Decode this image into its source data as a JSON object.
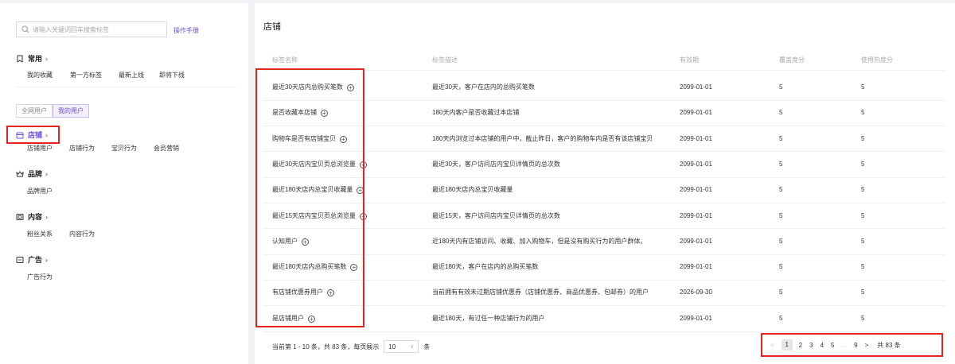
{
  "sidebar": {
    "search_placeholder": "请输入关键词回车搜索标签",
    "manual_link": "操作手册",
    "sections": [
      {
        "title": "常用",
        "items": [
          "我的收藏",
          "第一方标签",
          "最新上线",
          "即将下线"
        ]
      },
      {
        "title": "店铺",
        "items": [
          "店铺用户",
          "店铺行为",
          "宝贝行为",
          "会员营销"
        ]
      },
      {
        "title": "品牌",
        "items": [
          "品牌用户"
        ]
      },
      {
        "title": "内容",
        "items": [
          "粉丝关系",
          "内容行为"
        ]
      },
      {
        "title": "广告",
        "items": [
          "广告行为"
        ]
      }
    ],
    "scope_tabs": [
      "全网用户",
      "我的用户"
    ],
    "active_scope": "我的用户"
  },
  "main": {
    "title": "店铺",
    "columns": [
      "标签名称",
      "标签描述",
      "有效期",
      "覆盖度分",
      "使用热度分"
    ],
    "rows": [
      {
        "name": "最近30天店内总购买笔数",
        "desc": "最近30天，客户在店内的总购买笔数",
        "expiry": "2099-01-01",
        "coverage": "5",
        "heat": "5"
      },
      {
        "name": "是否收藏本店铺",
        "desc": "180天内客户是否收藏过本店铺",
        "expiry": "2099-01-01",
        "coverage": "5",
        "heat": "5"
      },
      {
        "name": "购物车是否有店铺宝贝",
        "desc": "180天内浏览过本店铺的用户中，截止昨日，客户的购物车内是否有该店铺宝贝",
        "expiry": "2099-01-01",
        "coverage": "5",
        "heat": "5"
      },
      {
        "name": "最近30天店内宝贝页总浏览量",
        "desc": "最近30天，客户访问店内宝贝详情页的总次数",
        "expiry": "2099-01-01",
        "coverage": "5",
        "heat": "5"
      },
      {
        "name": "最近180天店内总宝贝收藏量",
        "desc": "最近180天店内总宝贝收藏量",
        "expiry": "2099-01-01",
        "coverage": "5",
        "heat": "5"
      },
      {
        "name": "最近15天店内宝贝页总浏览量",
        "desc": "最近15天，客户访问店内宝贝详情页的总次数",
        "expiry": "2099-01-01",
        "coverage": "5",
        "heat": "5"
      },
      {
        "name": "认知用户",
        "desc": "近180天内有店铺访问、收藏、加入购物车，但是没有购买行为的用户群体。",
        "expiry": "2099-01-01",
        "coverage": "5",
        "heat": "5"
      },
      {
        "name": "最近180天店内总购买笔数",
        "desc": "最近180天，客户在店内的总购买笔数",
        "expiry": "2099-01-01",
        "coverage": "5",
        "heat": "5"
      },
      {
        "name": "有店铺优惠券用户",
        "desc": "当前拥有有效未过期店铺优惠券（店铺优惠券、商品优惠券、包邮券）的用户",
        "expiry": "2026-09-30",
        "coverage": "5",
        "heat": "5"
      },
      {
        "name": "是店铺用户",
        "desc": "最近180天，有过任一种店铺行为的用户",
        "expiry": "2099-01-01",
        "coverage": "5",
        "heat": "5"
      }
    ],
    "footer": {
      "range_text": "当前第 1 - 10 条，共 83 条，每页展示",
      "page_size": "10",
      "unit": "条"
    },
    "pagination": {
      "prev": "<",
      "pages": [
        "1",
        "2",
        "3",
        "4",
        "5",
        "...",
        "9"
      ],
      "next": ">",
      "total": "共 83 条"
    }
  },
  "colors": {
    "accent": "#6b4fd8",
    "highlight_border": "#e5241b"
  }
}
